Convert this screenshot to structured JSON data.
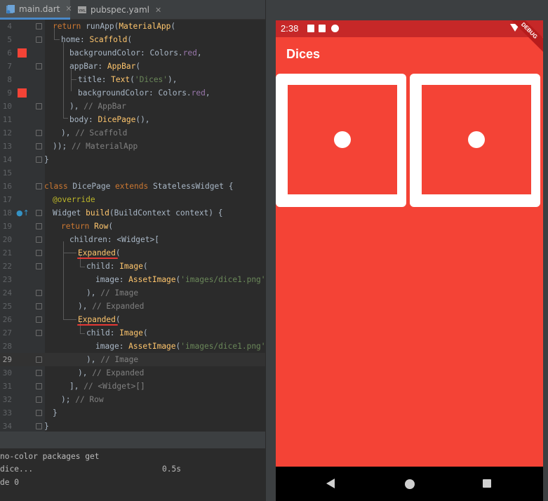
{
  "ide": {
    "tabs": [
      {
        "label": "main.dart",
        "icon": "dart-file-icon"
      },
      {
        "label": "pubspec.yaml",
        "icon": "yaml-file-icon"
      }
    ],
    "lines": [
      {
        "num": "4"
      },
      {
        "num": "5"
      },
      {
        "num": "6"
      },
      {
        "num": "7"
      },
      {
        "num": "8"
      },
      {
        "num": "9"
      },
      {
        "num": "10"
      },
      {
        "num": "11"
      },
      {
        "num": "12"
      },
      {
        "num": "13"
      },
      {
        "num": "14"
      },
      {
        "num": "15"
      },
      {
        "num": "16"
      },
      {
        "num": "17"
      },
      {
        "num": "18"
      },
      {
        "num": "19"
      },
      {
        "num": "20"
      },
      {
        "num": "21"
      },
      {
        "num": "22"
      },
      {
        "num": "23"
      },
      {
        "num": "24"
      },
      {
        "num": "25"
      },
      {
        "num": "26"
      },
      {
        "num": "27"
      },
      {
        "num": "28"
      },
      {
        "num": "29"
      },
      {
        "num": "30"
      },
      {
        "num": "31"
      },
      {
        "num": "32"
      },
      {
        "num": "33"
      },
      {
        "num": "34"
      }
    ],
    "code": {
      "l4": [
        "return",
        " runApp(",
        "MaterialApp",
        "("
      ],
      "l5": [
        "home",
        ": ",
        "Scaffold",
        "("
      ],
      "l6": [
        "backgroundColor",
        ": Colors.",
        "red",
        ","
      ],
      "l7": [
        "appBar",
        ": ",
        "AppBar",
        "("
      ],
      "l8": [
        "title",
        ": ",
        "Text",
        "(",
        "'Dices'",
        "),"
      ],
      "l9": [
        "backgroundColor",
        ": Colors.",
        "red",
        ","
      ],
      "l10": [
        "), ",
        "// AppBar"
      ],
      "l11": [
        "body",
        ": ",
        "DicePage",
        "(),"
      ],
      "l12": [
        "), ",
        "// Scaffold"
      ],
      "l13": [
        ")); ",
        "// MaterialApp"
      ],
      "l14": [
        "}"
      ],
      "l16": [
        "class",
        " DicePage ",
        "extends",
        " StatelessWidget {"
      ],
      "l17": [
        "@override"
      ],
      "l18": [
        "Widget ",
        "build",
        "(BuildContext context) {"
      ],
      "l19": [
        "return",
        " ",
        "Row",
        "("
      ],
      "l20": [
        "children",
        ": <Widget>["
      ],
      "l21": [
        "Expanded",
        "("
      ],
      "l22": [
        "child",
        ": ",
        "Image",
        "("
      ],
      "l23": [
        "image",
        ": ",
        "AssetImage",
        "(",
        "'images/dice1.png'",
        "),"
      ],
      "l24": [
        "), ",
        "// Image"
      ],
      "l25": [
        "), ",
        "// Expanded"
      ],
      "l26": [
        "Expanded",
        "("
      ],
      "l27": [
        "child",
        ": ",
        "Image",
        "("
      ],
      "l28": [
        "image",
        ": ",
        "AssetImage",
        "(",
        "'images/dice1.png'",
        "),"
      ],
      "l29": [
        "), ",
        "// Image"
      ],
      "l30": [
        "), ",
        "// Expanded"
      ],
      "l31": [
        "], ",
        "// <Widget>[]"
      ],
      "l32": [
        "); ",
        "// Row"
      ],
      "l33": [
        "}"
      ],
      "l34": [
        "}"
      ]
    },
    "console": {
      "line1": "no-color packages get",
      "line2": "dice...",
      "line2_time": "0.5s",
      "line3": "de 0"
    },
    "colors": {
      "swatch_red": "#f44336"
    }
  },
  "phone": {
    "status_time": "2:38",
    "app_title": "Dices",
    "debug_banner": "DEBUG",
    "dice": [
      {
        "label": "dice-one"
      },
      {
        "label": "dice-one"
      }
    ],
    "colors": {
      "background": "#f44336",
      "status_bar": "#c62828",
      "nav_bar": "#000000"
    }
  }
}
